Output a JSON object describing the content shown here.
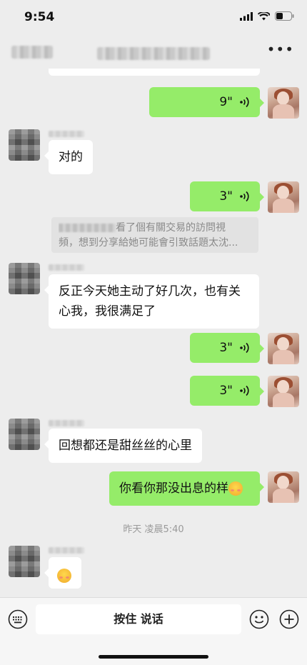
{
  "status_bar": {
    "time": "9:54"
  },
  "messages": [
    {
      "id": 1,
      "side": "right",
      "type": "voice",
      "duration": "9\""
    },
    {
      "id": 2,
      "side": "left",
      "type": "text",
      "text": "对的"
    },
    {
      "id": 3,
      "side": "right",
      "type": "voice",
      "duration": "3\""
    },
    {
      "id": 4,
      "type": "quote",
      "line1_visible": "看了個有關交易的訪問視",
      "line2": "頻，想到分享給她可能會引致話題太沈..."
    },
    {
      "id": 5,
      "side": "left",
      "type": "text",
      "line1": "反正今天她主动了好几次，也有关",
      "line2": "心我，我很满足了"
    },
    {
      "id": 6,
      "side": "right",
      "type": "voice",
      "duration": "3\""
    },
    {
      "id": 7,
      "side": "right",
      "type": "voice",
      "duration": "3\""
    },
    {
      "id": 8,
      "side": "left",
      "type": "text",
      "text": "回想都还是甜丝丝的心里"
    },
    {
      "id": 9,
      "side": "right",
      "type": "text",
      "text": "你看你那没出息的样"
    },
    {
      "id": 10,
      "type": "timestamp",
      "text": "昨天 凌晨5:40"
    },
    {
      "id": 11,
      "side": "left",
      "type": "emoji",
      "icon": "blushing-face-emoji"
    }
  ],
  "input_bar": {
    "hold_to_talk_label": "按住 说话"
  },
  "colors": {
    "self_bubble": "#95ec69",
    "other_bubble": "#ffffff",
    "background": "#ededed"
  }
}
